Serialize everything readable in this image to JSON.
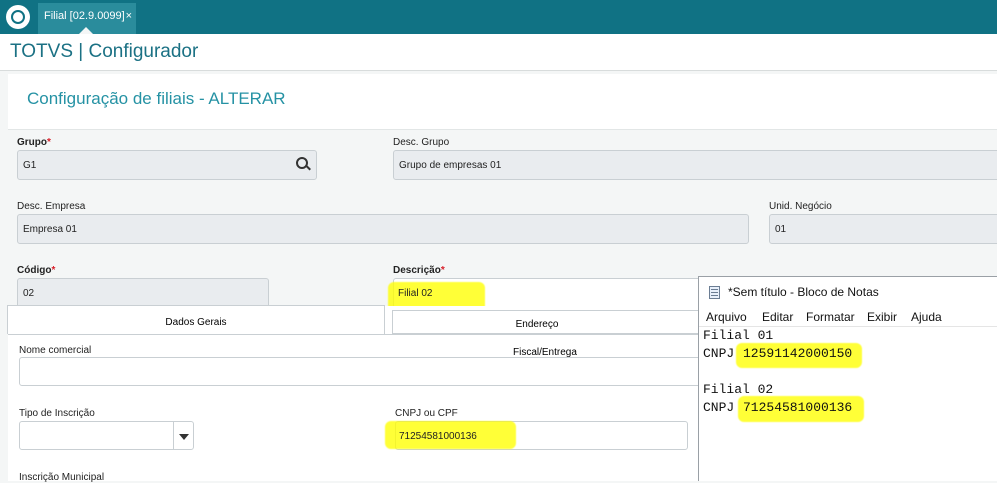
{
  "tab": {
    "label": "Filial [02.9.0099]",
    "close": "×"
  },
  "app": {
    "title": "TOTVS | Configurador"
  },
  "page": {
    "title": "Configuração de filiais - ALTERAR"
  },
  "form": {
    "grupo": {
      "label": "Grupo",
      "required": "*",
      "value": "G1"
    },
    "desc_grupo": {
      "label": "Desc. Grupo",
      "value": "Grupo de empresas 01"
    },
    "desc_empresa": {
      "label": "Desc. Empresa",
      "value": "Empresa 01"
    },
    "unid_negocio": {
      "label": "Unid. Negócio",
      "value": "01"
    },
    "codigo": {
      "label": "Código",
      "required": "*",
      "value": "02"
    },
    "descricao": {
      "label": "Descrição",
      "required": "*",
      "value": "Filial 02"
    }
  },
  "tabs": {
    "dados_gerais": "Dados Gerais",
    "endereco": "Endereço Fiscal/Entrega"
  },
  "dados_gerais": {
    "nome_comercial": {
      "label": "Nome comercial",
      "value": ""
    },
    "tipo_inscricao": {
      "label": "Tipo de Inscrição",
      "value": ""
    },
    "cnpj": {
      "label": "CNPJ ou CPF",
      "value": "71254581000136"
    },
    "inscricao_municipal": {
      "label": "Inscrição Municipal"
    }
  },
  "notepad": {
    "title": "*Sem título - Bloco de Notas",
    "menu": [
      "Arquivo",
      "Editar",
      "Formatar",
      "Exibir",
      "Ajuda"
    ],
    "lines": [
      {
        "label": "Filial 01"
      },
      {
        "prefix": "CNPJ",
        "value": "12591142000150"
      },
      {
        "label": "Filial 02"
      },
      {
        "prefix": "CNPJ",
        "value": "71254581000136"
      }
    ]
  },
  "colors": {
    "brand": "#107284",
    "title": "#2592a4",
    "required": "#d8202a",
    "highlight": "#ffff00"
  }
}
